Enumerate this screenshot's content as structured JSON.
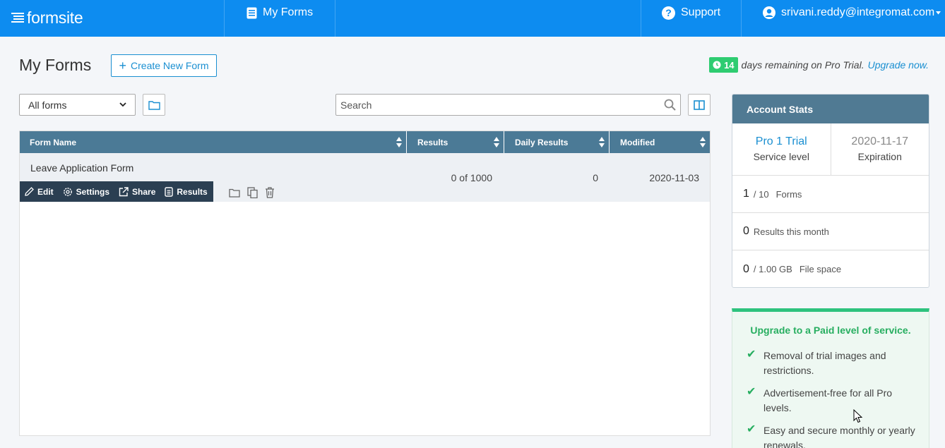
{
  "app": {
    "logo_text": "formsite"
  },
  "nav": {
    "my_forms": "My Forms",
    "support": "Support",
    "user_email": "srivani.reddy@integromat.com"
  },
  "header": {
    "title": "My Forms",
    "create_button": "Create New Form",
    "trial_days": "14",
    "trial_text": "days remaining on Pro Trial.",
    "upgrade_link": "Upgrade now."
  },
  "toolbar": {
    "filter_selected": "All forms",
    "search_placeholder": "Search"
  },
  "table": {
    "columns": [
      "Form Name",
      "Results",
      "Daily Results",
      "Modified"
    ],
    "rows": [
      {
        "name": "Leave Application Form",
        "results": "0 of 1000",
        "daily_results": "0",
        "modified": "2020-11-03",
        "actions": [
          "Edit",
          "Settings",
          "Share",
          "Results"
        ]
      }
    ]
  },
  "account_stats": {
    "title": "Account Stats",
    "service_level": "Pro 1 Trial",
    "service_level_label": "Service level",
    "expiration": "2020-11-17",
    "expiration_label": "Expiration",
    "forms_used": "1",
    "forms_limit": "/ 10",
    "forms_label": "Forms",
    "results_month": "0",
    "results_month_label": "Results this month",
    "file_space_used": "0",
    "file_space_limit": "/ 1.00 GB",
    "file_space_label": "File space"
  },
  "upgrade": {
    "title": "Upgrade to a Paid level of service.",
    "items": [
      "Removal of trial images and restrictions.",
      "Advertisement-free for all Pro levels.",
      "Easy and secure monthly or yearly renewals."
    ]
  },
  "colors": {
    "topbar": "#0d8cf0",
    "table_header": "#4b7a96",
    "actions_bar": "#2b3f52",
    "accent": "#1a8fd1",
    "success": "#2ecc71"
  }
}
